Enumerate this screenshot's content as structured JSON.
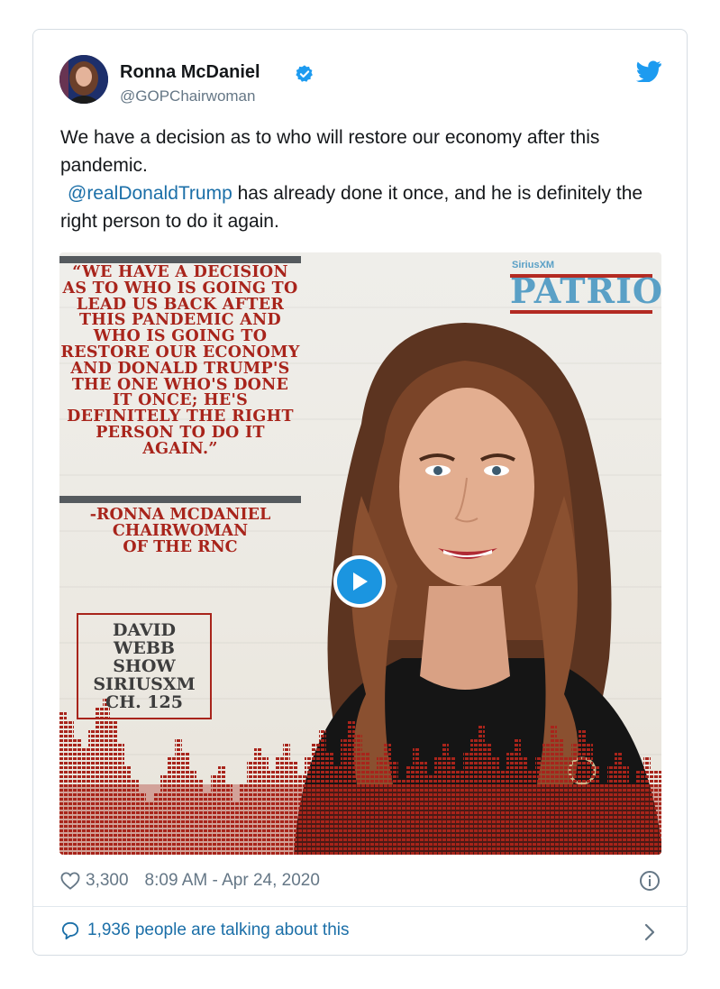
{
  "author": {
    "display_name": "Ronna McDaniel",
    "handle": "@GOPChairwoman",
    "verified": true
  },
  "tweet": {
    "text_line1": "We have a decision as to who will restore our economy after this pandemic.",
    "mention": "@realDonaldTrump",
    "text_line2": " has already done it once, and he is definitely the right person to do it again."
  },
  "media": {
    "quote": "“We have a decision as to who is going to lead us back after this pandemic and who is going to restore our economy and Donald Trump's the one who's done it once; he's definitely the right person to do it again.”",
    "attribution_lines": [
      "-RONNA MCDANIEL",
      "CHAIRWOMAN",
      "OF THE RNC"
    ],
    "show_lines": [
      "DAVID",
      "WEBB",
      "SHOW",
      "SIRIUSXM",
      "CH. 125"
    ],
    "brand_small": "SiriusXM",
    "brand_big": "PATRIOT",
    "type": "video"
  },
  "footer": {
    "likes": "3,300",
    "timestamp": "8:09 AM - Apr 24, 2020",
    "talking": "1,936 people are talking about this"
  },
  "colors": {
    "accent": "#1b95e0",
    "link": "#1b6fa8",
    "quote_red": "#a8241b",
    "muted": "#657786"
  },
  "icons": [
    "verified-badge-icon",
    "twitter-bird-icon",
    "play-icon",
    "heart-icon",
    "info-icon",
    "speech-bubble-icon",
    "chevron-right-icon"
  ]
}
